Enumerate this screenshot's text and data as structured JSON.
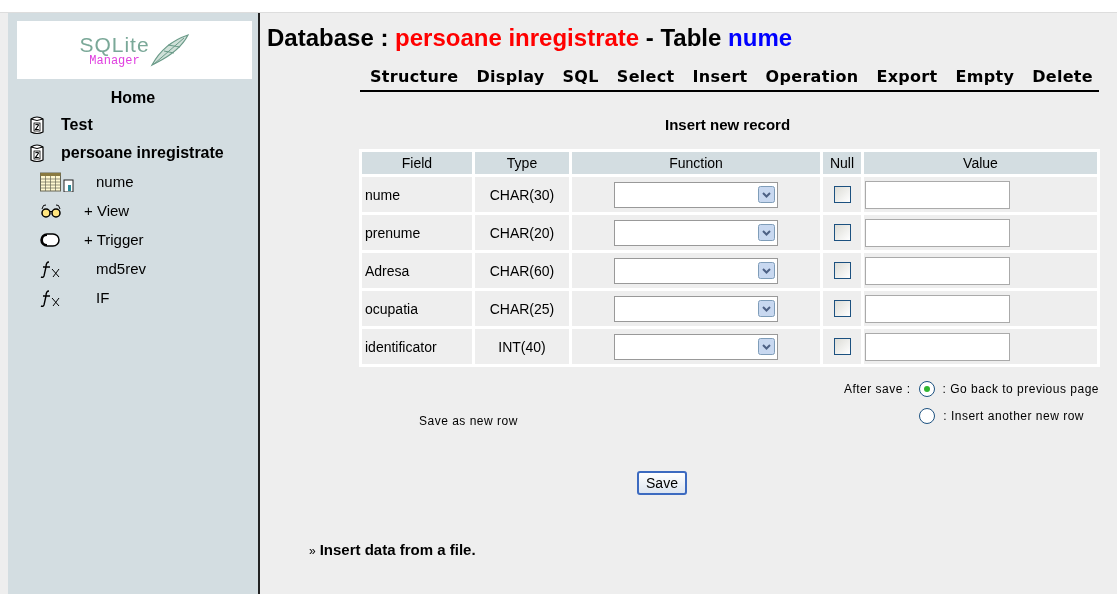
{
  "sidebar": {
    "logo": {
      "title": "SQLite",
      "subtitle": "Manager"
    },
    "home": "Home",
    "items": [
      {
        "kind": "database",
        "label": "Test"
      },
      {
        "kind": "database",
        "label": "persoane inregistrate"
      },
      {
        "kind": "table",
        "label": "nume"
      },
      {
        "kind": "view",
        "label": "+ View"
      },
      {
        "kind": "trigger",
        "label": "+ Trigger"
      },
      {
        "kind": "function",
        "label": "md5rev"
      },
      {
        "kind": "function",
        "label": "IF"
      }
    ]
  },
  "heading": {
    "prefix": "Database : ",
    "database": "persoane inregistrate",
    "middle": " - Table ",
    "table": "nume"
  },
  "tabs": [
    "Structure",
    "Display",
    "SQL",
    "Select",
    "Insert",
    "Operation",
    "Export",
    "Empty",
    "Delete"
  ],
  "form": {
    "title": "Insert new record",
    "columns": [
      "Field",
      "Type",
      "Function",
      "Null",
      "Value"
    ],
    "rows": [
      {
        "field": "nume",
        "type": "CHAR(30)",
        "null": false
      },
      {
        "field": "prenume",
        "type": "CHAR(20)",
        "null": false
      },
      {
        "field": "Adresa",
        "type": "CHAR(60)",
        "null": false
      },
      {
        "field": "ocupatia",
        "type": "CHAR(25)",
        "null": false
      },
      {
        "field": "identificator",
        "type": "INT(40)",
        "null": false
      }
    ],
    "save_mode": "Save as new row",
    "after_save": "After save :",
    "options": [
      {
        "label": ": Go back to previous page",
        "selected": true
      },
      {
        "label": ": Insert another new row",
        "selected": false
      }
    ],
    "save_button": "Save"
  },
  "footer": {
    "marker": "»",
    "link": "Insert data from a file."
  }
}
